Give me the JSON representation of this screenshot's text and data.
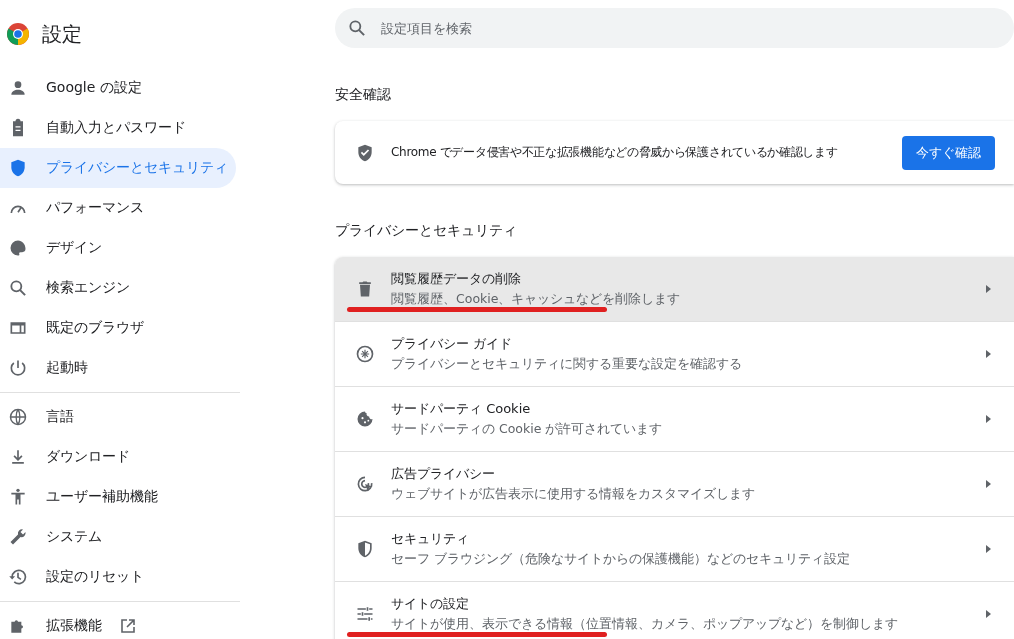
{
  "app": {
    "title": "設定"
  },
  "sidebar": {
    "groups": [
      [
        {
          "label": "Google の設定",
          "selected": false
        },
        {
          "label": "自動入力とパスワード",
          "selected": false
        },
        {
          "label": "プライバシーとセキュリティ",
          "selected": true
        },
        {
          "label": "パフォーマンス",
          "selected": false
        },
        {
          "label": "デザイン",
          "selected": false
        },
        {
          "label": "検索エンジン",
          "selected": false
        },
        {
          "label": "既定のブラウザ",
          "selected": false
        },
        {
          "label": "起動時",
          "selected": false
        }
      ],
      [
        {
          "label": "言語",
          "selected": false
        },
        {
          "label": "ダウンロード",
          "selected": false
        },
        {
          "label": "ユーザー補助機能",
          "selected": false
        },
        {
          "label": "システム",
          "selected": false
        },
        {
          "label": "設定のリセット",
          "selected": false
        }
      ],
      [
        {
          "label": "拡張機能",
          "selected": false,
          "external": true
        }
      ]
    ]
  },
  "search": {
    "placeholder": "設定項目を検索"
  },
  "safety_check": {
    "heading": "安全確認",
    "text": "Chrome でデータ侵害や不正な拡張機能などの脅威から保護されているか確認します",
    "button": "今すぐ確認"
  },
  "privacy": {
    "heading": "プライバシーとセキュリティ",
    "rows": [
      {
        "title": "閲覧履歴データの削除",
        "subtitle": "閲覧履歴、Cookie、キャッシュなどを削除します",
        "hovered": true,
        "underlined": true
      },
      {
        "title": "プライバシー ガイド",
        "subtitle": "プライバシーとセキュリティに関する重要な設定を確認する",
        "hovered": false,
        "underlined": false
      },
      {
        "title": "サードパーティ Cookie",
        "subtitle": "サードパーティの Cookie が許可されています",
        "hovered": false,
        "underlined": false
      },
      {
        "title": "広告プライバシー",
        "subtitle": "ウェブサイトが広告表示に使用する情報をカスタマイズします",
        "hovered": false,
        "underlined": false
      },
      {
        "title": "セキュリティ",
        "subtitle": "セーフ ブラウジング（危険なサイトからの保護機能）などのセキュリティ設定",
        "hovered": false,
        "underlined": false
      },
      {
        "title": "サイトの設定",
        "subtitle": "サイトが使用、表示できる情報（位置情報、カメラ、ポップアップなど）を制御します",
        "hovered": false,
        "underlined": true
      }
    ]
  }
}
